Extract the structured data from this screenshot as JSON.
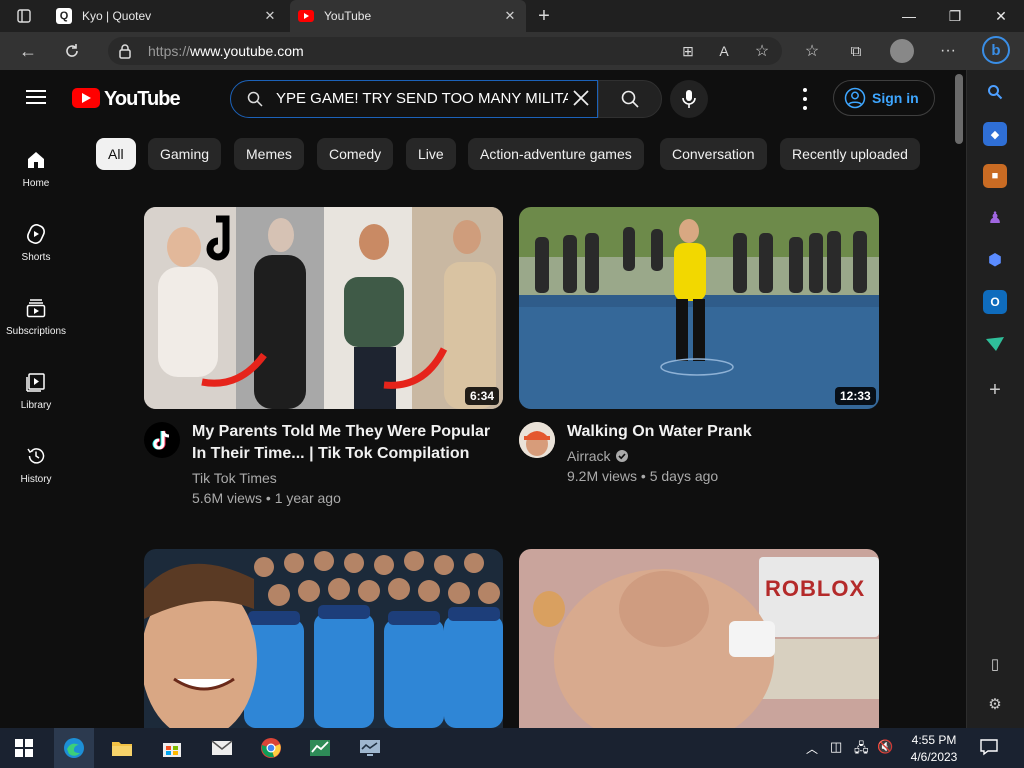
{
  "browser": {
    "tabs": [
      {
        "label": "Kyo | Quotev",
        "favicon": "Q"
      },
      {
        "label": "YouTube",
        "favicon": "youtube-icon"
      }
    ],
    "url_scheme": "https://",
    "url_host": "www.youtube.com"
  },
  "youtube": {
    "logo_text": "YouTube",
    "search_value": "YPE GAME! TRY SEND TOO MANY MILITA",
    "signin_label": "Sign in",
    "nav": [
      {
        "label": "Home",
        "icon": "home-icon"
      },
      {
        "label": "Shorts",
        "icon": "shorts-icon"
      },
      {
        "label": "Subscriptions",
        "icon": "subscriptions-icon"
      },
      {
        "label": "Library",
        "icon": "library-icon"
      },
      {
        "label": "History",
        "icon": "history-icon"
      }
    ],
    "chips": [
      "All",
      "Gaming",
      "Memes",
      "Comedy",
      "Live",
      "Action-adventure games",
      "Conversation",
      "Recently uploaded"
    ],
    "videos": [
      {
        "title_line1": "My Parents Told Me They Were Popular",
        "title_line2": "In Their Time... | Tik Tok Compilation",
        "channel": "Tik Tok Times",
        "meta": "5.6M views • 1 year ago",
        "duration": "6:34"
      },
      {
        "title_line1": "Walking On Water Prank",
        "title_line2": "",
        "channel": "Airrack",
        "meta": "9.2M views • 5 days ago",
        "duration": "12:33"
      }
    ],
    "thumb3_text": "",
    "thumb4_text": "ROBLOX"
  },
  "taskbar": {
    "time": "4:55 PM",
    "date": "4/6/2023"
  },
  "colors": {
    "accent": "#3ea6ff",
    "youtube_red": "#ff0000",
    "background": "#0f0f0f"
  }
}
